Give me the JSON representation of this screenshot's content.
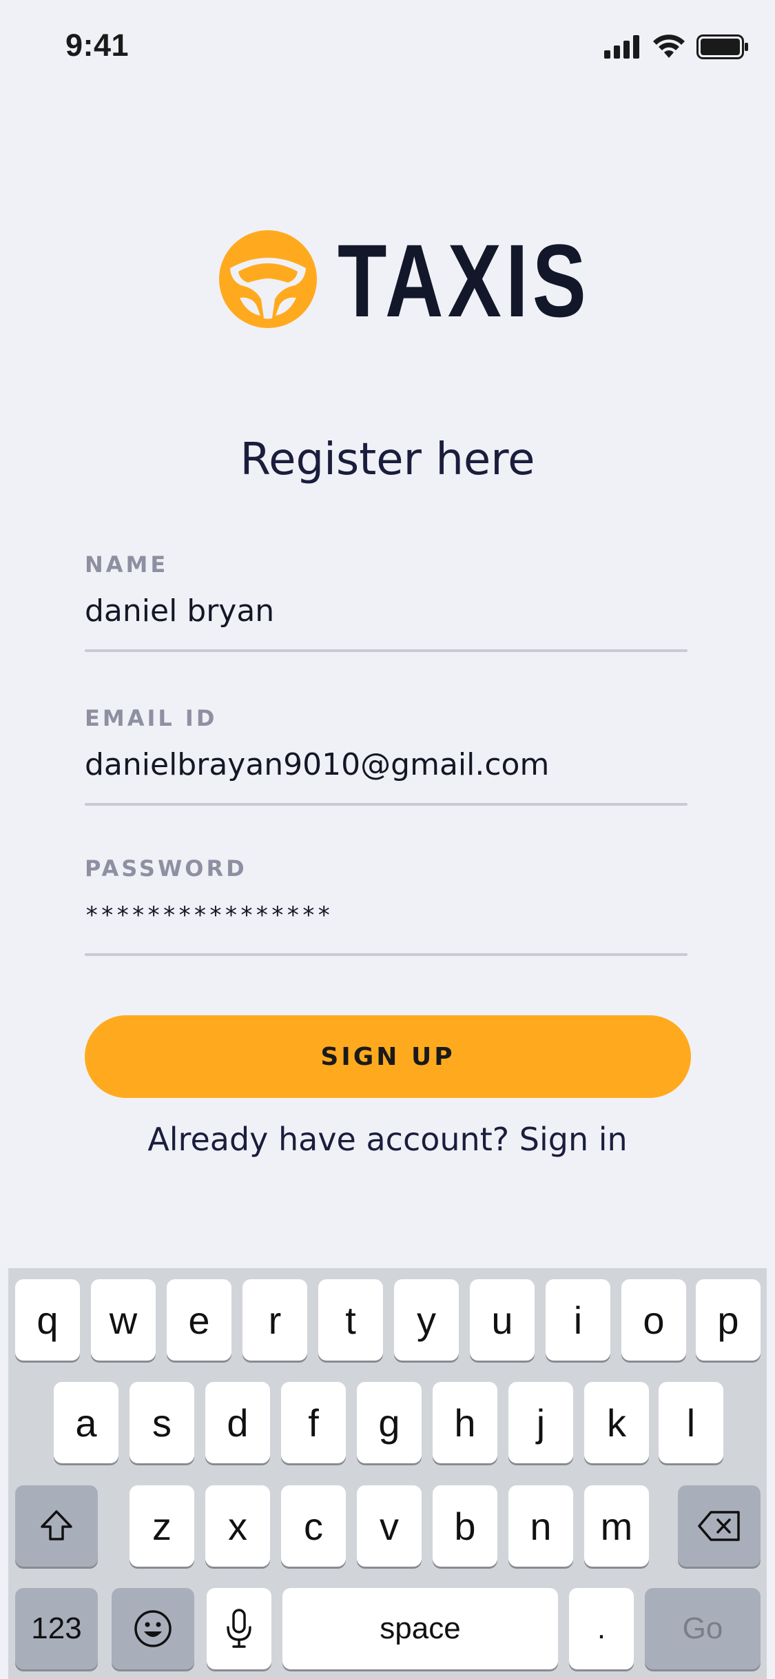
{
  "status_bar": {
    "time": "9:41",
    "icons": [
      "cellular-signal-icon",
      "wifi-icon",
      "battery-icon"
    ]
  },
  "brand": {
    "name": "TAXIS",
    "icon": "steering-wheel-icon",
    "accent_color": "#ffaa1e"
  },
  "page": {
    "title": "Register here"
  },
  "form": {
    "name_label": "NAME",
    "name_value": "daniel bryan",
    "email_label": "EMAIL ID",
    "email_value": "danielbrayan9010@gmail.com",
    "password_label": "PASSWORD",
    "password_value": "****************",
    "signup_label": "SIGN UP",
    "signin_text": "Already have account? Sign in"
  },
  "keyboard": {
    "row1": [
      "q",
      "w",
      "e",
      "r",
      "t",
      "y",
      "u",
      "i",
      "o",
      "p"
    ],
    "row2": [
      "a",
      "s",
      "d",
      "f",
      "g",
      "h",
      "j",
      "k",
      "l"
    ],
    "row3": [
      "z",
      "x",
      "c",
      "v",
      "b",
      "n",
      "m"
    ],
    "numbers_label": "123",
    "space_label": "space",
    "period_label": ".",
    "go_label": "Go",
    "icons": [
      "shift-icon",
      "backspace-icon",
      "emoji-icon",
      "microphone-icon"
    ]
  }
}
